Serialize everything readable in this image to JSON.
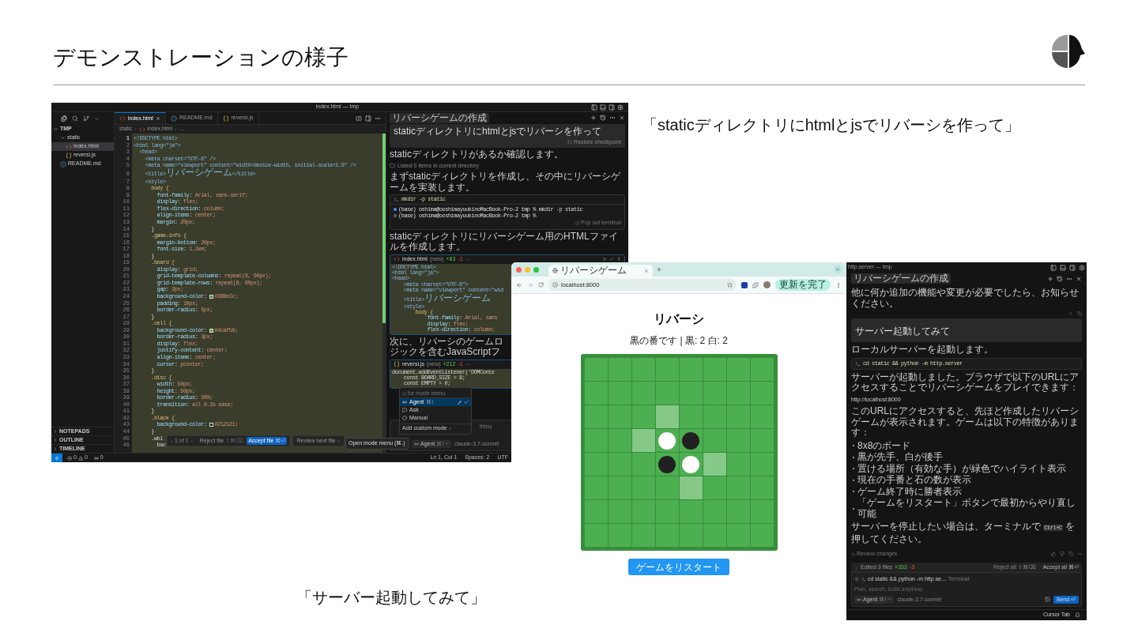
{
  "slide": {
    "title": "デモンストレーションの様子"
  },
  "quotes": [
    "「staticディレクトリにhtmlとjsでリバーシを作って」",
    "「サーバー起動してみて」"
  ],
  "editor_window": {
    "title": "index.html — tmp",
    "explorer": {
      "root": "TMP",
      "tree": [
        {
          "label": "static",
          "kind": "folder",
          "expanded": true,
          "selected": false,
          "children": [
            {
              "label": "index.html",
              "kind": "html",
              "selected": true
            },
            {
              "label": "reversi.js",
              "kind": "js",
              "selected": false
            }
          ]
        },
        {
          "label": "README.md",
          "kind": "info",
          "selected": false
        }
      ],
      "sections": [
        "NOTEPADS",
        "OUTLINE",
        "TIMELINE"
      ]
    },
    "tabs": [
      {
        "label": "index.html",
        "kind": "html",
        "selected": true
      },
      {
        "label": "README.md",
        "kind": "info",
        "selected": false
      },
      {
        "label": "reversi.js",
        "kind": "js",
        "selected": false
      }
    ],
    "breadcrumb": [
      "static",
      "index.html",
      "..."
    ],
    "code_lines": [
      {
        "n": "1",
        "text": "<!DOCTYPE html>"
      },
      {
        "n": "2",
        "text": "<html lang=\"ja\">"
      },
      {
        "n": "3",
        "text": "  <head>"
      },
      {
        "n": "4",
        "text": "    <meta charset=\"UTF-8\" />"
      },
      {
        "n": "5",
        "text": "    <meta name=\"viewport\" content=\"width=device-width, initial-scale=1.0\" />"
      },
      {
        "n": "6",
        "text": "    <title>リバーシゲーム</title>"
      },
      {
        "n": "7",
        "text": "    <style>"
      },
      {
        "n": "8",
        "text": "      body {"
      },
      {
        "n": "9",
        "text": "        font-family: Arial, sans-serif;"
      },
      {
        "n": "10",
        "text": "        display: flex;"
      },
      {
        "n": "11",
        "text": "        flex-direction: column;"
      },
      {
        "n": "12",
        "text": "        align-items: center;"
      },
      {
        "n": "13",
        "text": "        margin: 20px;"
      },
      {
        "n": "14",
        "text": "      }"
      },
      {
        "n": "15",
        "text": "      .game-info {"
      },
      {
        "n": "16",
        "text": "        margin-bottom: 20px;"
      },
      {
        "n": "17",
        "text": "        font-size: 1.2em;"
      },
      {
        "n": "18",
        "text": "      }"
      },
      {
        "n": "19",
        "text": "      .board {"
      },
      {
        "n": "20",
        "text": "        display: grid;"
      },
      {
        "n": "21",
        "text": "        grid-template-columns: repeat(8, 60px);"
      },
      {
        "n": "22",
        "text": "        grid-template-rows: repeat(8, 60px);"
      },
      {
        "n": "23",
        "text": "        gap: 2px;"
      },
      {
        "n": "24",
        "text": "        background-color: ",
        "color": "#388e3c",
        "rest": "#388e3c;"
      },
      {
        "n": "25",
        "text": "        padding: 10px;"
      },
      {
        "n": "26",
        "text": "        border-radius: 5px;"
      },
      {
        "n": "27",
        "text": "      }"
      },
      {
        "n": "28",
        "text": "      .cell {"
      },
      {
        "n": "29",
        "text": "        background-color: ",
        "color": "#4caf50",
        "rest": "#4caf50;"
      },
      {
        "n": "30",
        "text": "        border-radius: 3px;"
      },
      {
        "n": "31",
        "text": "        display: flex;"
      },
      {
        "n": "32",
        "text": "        justify-content: center;"
      },
      {
        "n": "33",
        "text": "        align-items: center;"
      },
      {
        "n": "34",
        "text": "        cursor: pointer;"
      },
      {
        "n": "35",
        "text": "      }"
      },
      {
        "n": "36",
        "text": "      .disc {"
      },
      {
        "n": "37",
        "text": "        width: 50px;"
      },
      {
        "n": "38",
        "text": "        height: 50px;"
      },
      {
        "n": "39",
        "text": "        border-radius: 50%;"
      },
      {
        "n": "40",
        "text": "        transition: all 0.3s ease;"
      },
      {
        "n": "41",
        "text": "      }"
      },
      {
        "n": "42",
        "text": "      .black {"
      },
      {
        "n": "43",
        "text": "        background-color: ",
        "color": "#212121",
        "rest": "#212121;"
      },
      {
        "n": "44",
        "text": "      }"
      },
      {
        "n": "45",
        "text": "      .whi"
      },
      {
        "n": "46",
        "text": "        bac"
      }
    ],
    "review_bar": {
      "counter": "1 of 1",
      "reject": "Reject file",
      "reject_keys": "⇧⌘⌫",
      "accept": "Accept file",
      "accept_keys": "⌘⏎",
      "next": "Review next file"
    },
    "tooltip": "Open mode menu (⌘.)",
    "status_bar": {
      "errors": "0",
      "warnings": "0",
      "ports": "0",
      "position": "Ln 1, Col 1",
      "indent": "Spaces: 2",
      "encoding": "UTF"
    },
    "chat": {
      "title": "リバーシゲームの作成",
      "user_message": "staticディレクトリにhtmlとjsでリバーシを作って",
      "restore": "Restore checkpoint",
      "items": [
        {
          "kind": "text",
          "text": "staticディレクトリがあるか確認します。"
        },
        {
          "kind": "tool",
          "text": "Listed 0 items in current directory"
        },
        {
          "kind": "text",
          "text": "まずstaticディレクトリを作成し、その中にリバーシゲームを実装します。"
        },
        {
          "kind": "terminal",
          "command": "mkdir -p static",
          "output": [
            {
              "text": "(base) oshima@ooshimayuukinoMacBook-Pro-2 tmp % mkdir -p static",
              "kind": "done"
            },
            {
              "text": "(base) oshima@ooshimayuukinoMacBook-Pro-2 tmp %",
              "kind": "idle"
            }
          ],
          "action": "Pop out terminal"
        },
        {
          "kind": "text",
          "text": "staticディレクトリにリバーシゲーム用のHTMLファイルを作成します。"
        },
        {
          "kind": "html_file",
          "name": "index.html",
          "status": "(new)",
          "added": "+83",
          "removed": "-1",
          "lines": [
            "<!DOCTYPE html>",
            "<html lang=\"ja\">",
            "<head>",
            "    <meta charset=\"UTF-8\">",
            "    <meta name=\"viewport\" content=\"wid",
            "    <title>リバーシゲーム",
            "    <style>",
            "        body {",
            "            font-family: Arial, sans",
            "            display: flex;",
            "            flex-direction: column;"
          ]
        },
        {
          "kind": "narrow_text",
          "text": "次に、リバーシのゲームロジックを含むJavaScriptフ"
        },
        {
          "kind": "js_file",
          "name": "reversi.js",
          "status": "(new)",
          "added": "+212",
          "removed": "-1",
          "lines": [
            "document.addEventListener('DOMConte",
            "    const BOARD_SIZE = 8;",
            "    const EMPTY = 0;"
          ]
        }
      ],
      "composer": {
        "placeholder": "thing",
        "mode": "Agent",
        "mode_keys": "⌘I",
        "model": "claude-3.7-sonnet"
      },
      "mode_menu": {
        "search": "for mode menu",
        "options": [
          {
            "label": "Agent",
            "keys": "⌘I",
            "kind": "agent",
            "selected": true
          },
          {
            "label": "Ask",
            "kind": "ask",
            "selected": false
          },
          {
            "label": "Manual",
            "kind": "manual",
            "selected": false
          }
        ],
        "add": "Add custom mode"
      }
    }
  },
  "browser": {
    "tab": "リバーシゲーム",
    "url": "localhost:8000",
    "update_button": "更新を完了",
    "heading": "リバーシ",
    "status": "黒の番です | 黒: 2 白: 2",
    "board": [
      [
        {
          "kind": "empty"
        },
        {
          "kind": "empty"
        },
        {
          "kind": "empty"
        },
        {
          "kind": "empty"
        },
        {
          "kind": "empty"
        },
        {
          "kind": "empty"
        },
        {
          "kind": "empty"
        },
        {
          "kind": "empty"
        }
      ],
      [
        {
          "kind": "empty"
        },
        {
          "kind": "empty"
        },
        {
          "kind": "empty"
        },
        {
          "kind": "empty"
        },
        {
          "kind": "empty"
        },
        {
          "kind": "empty"
        },
        {
          "kind": "empty"
        },
        {
          "kind": "empty"
        }
      ],
      [
        {
          "kind": "empty"
        },
        {
          "kind": "empty"
        },
        {
          "kind": "empty"
        },
        {
          "kind": "hint"
        },
        {
          "kind": "empty"
        },
        {
          "kind": "empty"
        },
        {
          "kind": "empty"
        },
        {
          "kind": "empty"
        }
      ],
      [
        {
          "kind": "empty"
        },
        {
          "kind": "empty"
        },
        {
          "kind": "hint"
        },
        {
          "kind": "white"
        },
        {
          "kind": "black"
        },
        {
          "kind": "empty"
        },
        {
          "kind": "empty"
        },
        {
          "kind": "empty"
        }
      ],
      [
        {
          "kind": "empty"
        },
        {
          "kind": "empty"
        },
        {
          "kind": "empty"
        },
        {
          "kind": "black"
        },
        {
          "kind": "white"
        },
        {
          "kind": "hint"
        },
        {
          "kind": "empty"
        },
        {
          "kind": "empty"
        }
      ],
      [
        {
          "kind": "empty"
        },
        {
          "kind": "empty"
        },
        {
          "kind": "empty"
        },
        {
          "kind": "empty"
        },
        {
          "kind": "hint"
        },
        {
          "kind": "empty"
        },
        {
          "kind": "empty"
        },
        {
          "kind": "empty"
        }
      ],
      [
        {
          "kind": "empty"
        },
        {
          "kind": "empty"
        },
        {
          "kind": "empty"
        },
        {
          "kind": "empty"
        },
        {
          "kind": "empty"
        },
        {
          "kind": "empty"
        },
        {
          "kind": "empty"
        },
        {
          "kind": "empty"
        }
      ],
      [
        {
          "kind": "empty"
        },
        {
          "kind": "empty"
        },
        {
          "kind": "empty"
        },
        {
          "kind": "empty"
        },
        {
          "kind": "empty"
        },
        {
          "kind": "empty"
        },
        {
          "kind": "empty"
        },
        {
          "kind": "empty"
        }
      ]
    ],
    "restart": "ゲームをリスタート"
  },
  "chat_window": {
    "title": "http.server — tmp",
    "chat_title": "リバーシゲームの作成",
    "items": [
      {
        "kind": "text",
        "text": "他に何か追加の機能や変更が必要でしたら、お知らせください。"
      },
      {
        "kind": "user",
        "text": "サーバー起動してみて"
      },
      {
        "kind": "text",
        "text": "ローカルサーバーを起動します。"
      },
      {
        "kind": "command",
        "text": "cd static && python -m http.server"
      },
      {
        "kind": "text",
        "text": "サーバーが起動しました。ブラウザで以下のURLにアクセスすることでリバーシゲームをプレイできます："
      },
      {
        "kind": "link",
        "text": "http://localhost:8000"
      },
      {
        "kind": "text",
        "text": "このURLにアクセスすると、先ほど作成したリバーシゲームが表示されます。ゲームは以下の特徴があります："
      },
      {
        "kind": "bullets",
        "items": [
          "8x8のボード",
          "黒が先手、白が後手",
          "置ける場所（有効な手）が緑色でハイライト表示",
          "現在の手番と石の数が表示",
          "ゲーム終了時に勝者表示",
          "「ゲームをリスタート」ボタンで最初からやり直し可能"
        ]
      },
      {
        "kind": "text_code",
        "before": "サーバーを停止したい場合は、ターミナルで ",
        "code": "Ctrl+C",
        "after": " を押してください。"
      },
      {
        "kind": "review",
        "text": "Review changes"
      }
    ],
    "changes": {
      "summary": "Edited 3 files",
      "added": "+333",
      "removed": "-3",
      "reject": "Reject all ⇧⌘⌫",
      "accept": "Accept all ⌘⏎"
    },
    "composer": {
      "context": "cd static && python -m http.se...",
      "context_kind": "Terminal",
      "placeholder": "Plan, search, build anything",
      "mode": "Agent",
      "mode_keys": "⌘I",
      "model": "claude-3.7-sonnet",
      "send": "Send ⏎"
    },
    "status": "Cursor Tab"
  }
}
